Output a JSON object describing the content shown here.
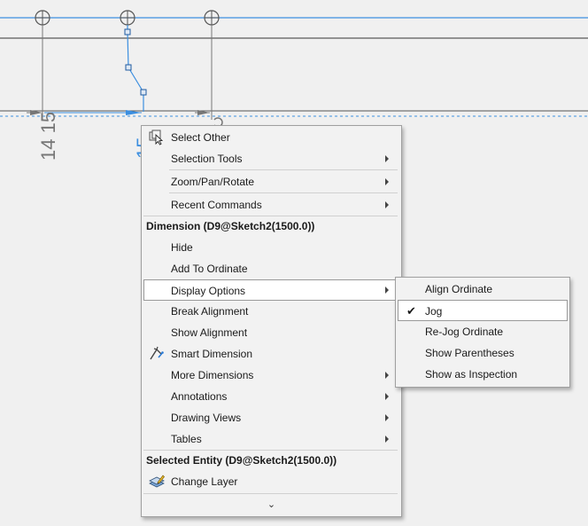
{
  "drawing": {
    "dimension_left": "14 15",
    "dimension_partial": "15"
  },
  "context_menu": {
    "items": [
      {
        "label": "Select Other",
        "icon": "select-other-icon"
      },
      {
        "label": "Selection Tools",
        "submenu": true
      },
      {
        "label": "Zoom/Pan/Rotate",
        "submenu": true
      },
      {
        "label": "Recent Commands",
        "submenu": true
      },
      {
        "label": "Dimension (D9@Sketch2(1500.0))",
        "header": true
      },
      {
        "label": "Hide"
      },
      {
        "label": "Add To Ordinate"
      },
      {
        "label": "Display Options",
        "submenu": true,
        "active": true
      },
      {
        "label": "Break Alignment"
      },
      {
        "label": "Show Alignment"
      },
      {
        "label": "Smart Dimension",
        "icon": "smart-dimension-icon"
      },
      {
        "label": "More Dimensions",
        "submenu": true
      },
      {
        "label": "Annotations",
        "submenu": true
      },
      {
        "label": "Drawing Views",
        "submenu": true
      },
      {
        "label": "Tables",
        "submenu": true
      },
      {
        "label": "Selected Entity (D9@Sketch2(1500.0))",
        "header": true
      },
      {
        "label": "Change Layer",
        "icon": "change-layer-icon"
      }
    ],
    "expand_glyph": "⌄"
  },
  "display_options_submenu": {
    "items": [
      {
        "label": "Align Ordinate"
      },
      {
        "label": "Jog",
        "checked": true
      },
      {
        "label": "Re-Jog Ordinate"
      },
      {
        "label": "Show Parentheses"
      },
      {
        "label": "Show as Inspection"
      }
    ],
    "check_glyph": "✔"
  },
  "colors": {
    "sketch_blue": "#3c8fe0",
    "menu_bg": "#f2f2f2",
    "hover_bg": "#ffffff"
  }
}
